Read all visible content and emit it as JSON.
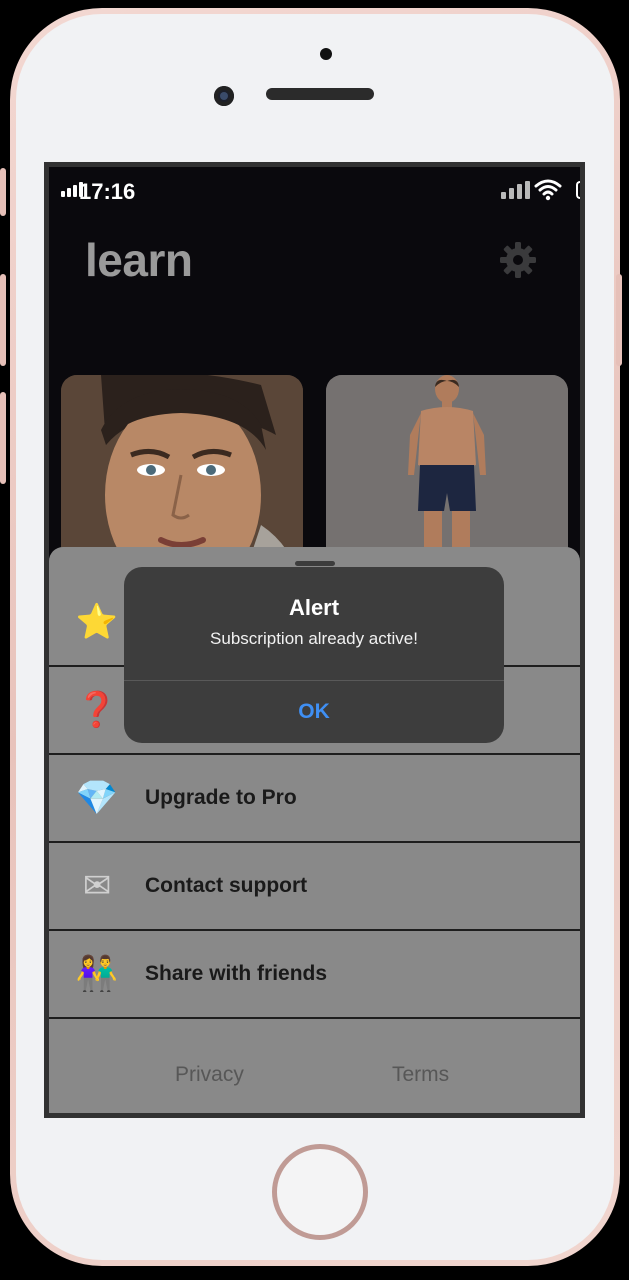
{
  "status_bar": {
    "time": "17:16"
  },
  "header": {
    "title": "learn",
    "settings_icon": "gear-icon"
  },
  "cards": [
    {
      "name": "face-card",
      "icon": "face-image"
    },
    {
      "name": "body-card",
      "icon": "physique-image"
    }
  ],
  "menu": {
    "items": [
      {
        "icon_name": "star-icon",
        "glyph": "⭐",
        "label": ""
      },
      {
        "icon_name": "question-icon",
        "glyph": "❓",
        "label": ""
      },
      {
        "icon_name": "diamond-icon",
        "glyph": "💎",
        "label": "Upgrade to Pro"
      },
      {
        "icon_name": "envelope-icon",
        "glyph": "✉",
        "label": "Contact support"
      },
      {
        "icon_name": "friends-icon",
        "glyph": "👫",
        "label": "Share with friends"
      }
    ]
  },
  "footer": {
    "privacy": "Privacy",
    "terms": "Terms"
  },
  "alert": {
    "title": "Alert",
    "message": "Subscription already active!",
    "ok_label": "OK",
    "ok_color": "#3f8ff3"
  }
}
